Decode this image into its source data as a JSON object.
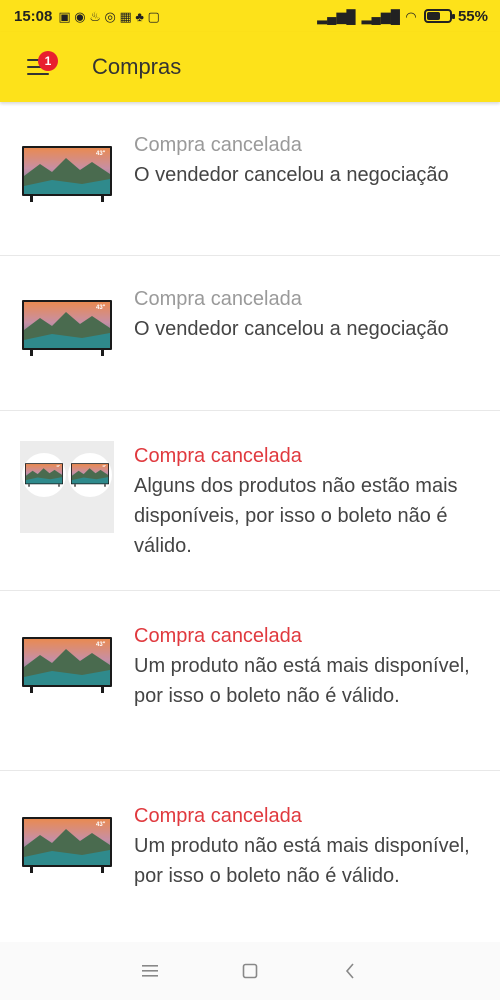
{
  "status_bar": {
    "time": "15:08",
    "battery_text": "55%",
    "battery_level": 0.55
  },
  "toolbar": {
    "title": "Compras",
    "badge_count": "1"
  },
  "purchases": [
    {
      "status": "Compra cancelada",
      "status_color": "#9a9a9a",
      "description": "O vendedor cancelou a negociação",
      "thumb": "tv-icon"
    },
    {
      "status": "Compra cancelada",
      "status_color": "#9a9a9a",
      "description": "O vendedor cancelou a negociação",
      "thumb": "tv-icon"
    },
    {
      "status": "Compra cancelada",
      "status_color": "#e0393e",
      "description": "Alguns dos produtos não estão mais disponíveis, por isso o boleto não é válido.",
      "thumb": "multi-tv-icon"
    },
    {
      "status": "Compra cancelada",
      "status_color": "#e0393e",
      "description": "Um produto não está mais disponível, por isso o boleto não é válido.",
      "thumb": "tv-icon"
    },
    {
      "status": "Compra cancelada",
      "status_color": "#e0393e",
      "description": "Um produto não está mais disponível, por isso o boleto não é válido.",
      "thumb": "tv-icon"
    }
  ],
  "colors": {
    "brand_yellow": "#fde21a",
    "badge_red": "#e8202e",
    "cancel_red": "#e0393e",
    "muted_gray": "#9a9a9a"
  }
}
